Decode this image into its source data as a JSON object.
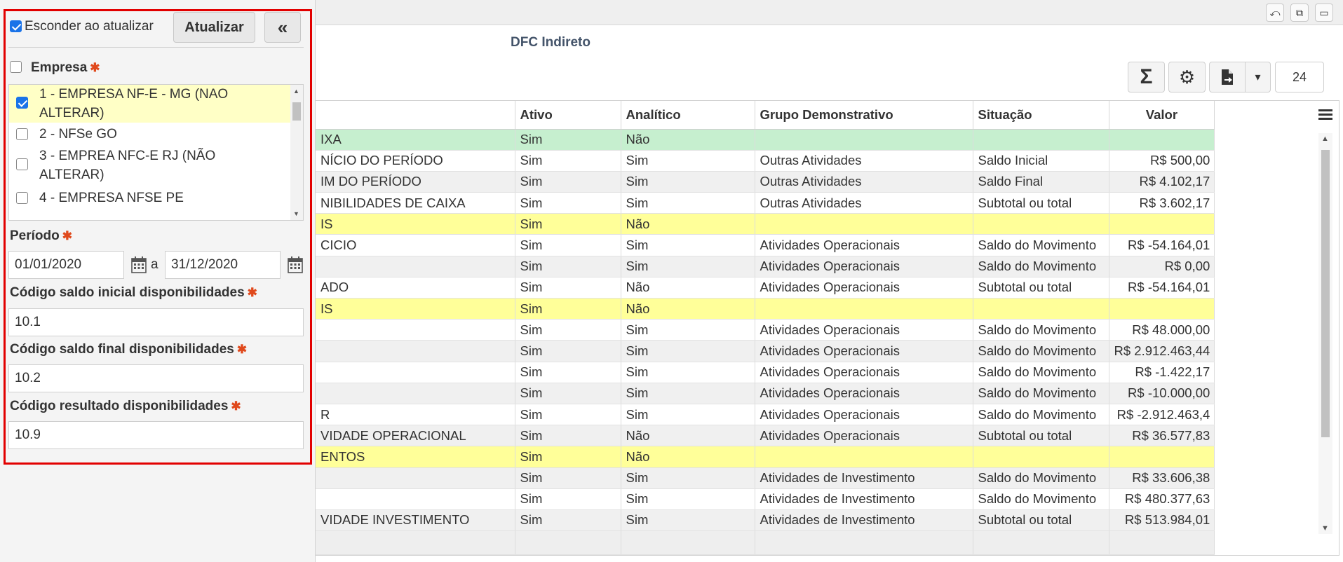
{
  "window": {
    "buttons": [
      {
        "name": "undo",
        "icon": "undo-icon",
        "glyph": "⤺"
      },
      {
        "name": "link",
        "icon": "link-icon",
        "glyph": "⧉"
      },
      {
        "name": "maximize",
        "icon": "maximize-icon",
        "glyph": "▭"
      }
    ]
  },
  "report": {
    "title": "DFC Indireto",
    "toolbar": {
      "sum_glyph": "Σ",
      "settings_glyph": "⚙",
      "export_glyph": "🗎",
      "dropdown_glyph": "▾",
      "page_size": "24"
    },
    "columns": [
      "",
      "Ativo",
      "Analítico",
      "Grupo Demonstrativo",
      "Situação",
      "Valor"
    ],
    "rows": [
      {
        "style": "green",
        "cells": [
          "IXA",
          "Sim",
          "Não",
          "",
          "",
          ""
        ]
      },
      {
        "style": "white",
        "cells": [
          "NÍCIO DO PERÍODO",
          "Sim",
          "Sim",
          "Outras Atividades",
          "Saldo Inicial",
          "R$ 500,00"
        ]
      },
      {
        "style": "gray",
        "cells": [
          "IM DO PERÍODO",
          "Sim",
          "Sim",
          "Outras Atividades",
          "Saldo Final",
          "R$ 4.102,17"
        ]
      },
      {
        "style": "white",
        "cells": [
          "NIBILIDADES DE CAIXA",
          "Sim",
          "Sim",
          "Outras Atividades",
          "Subtotal ou total",
          "R$ 3.602,17"
        ]
      },
      {
        "style": "yellow",
        "cells": [
          "IS",
          "Sim",
          "Não",
          "",
          "",
          ""
        ]
      },
      {
        "style": "white",
        "cells": [
          "CICIO",
          "Sim",
          "Sim",
          "Atividades Operacionais",
          "Saldo do Movimento",
          "R$ -54.164,01"
        ]
      },
      {
        "style": "gray",
        "cells": [
          "",
          "Sim",
          "Sim",
          "Atividades Operacionais",
          "Saldo do Movimento",
          "R$ 0,00"
        ]
      },
      {
        "style": "white",
        "cells": [
          "ADO",
          "Sim",
          "Não",
          "Atividades Operacionais",
          "Subtotal ou total",
          "R$ -54.164,01"
        ]
      },
      {
        "style": "yellow",
        "cells": [
          "IS",
          "Sim",
          "Não",
          "",
          "",
          ""
        ]
      },
      {
        "style": "white",
        "cells": [
          "",
          "Sim",
          "Sim",
          "Atividades Operacionais",
          "Saldo do Movimento",
          "R$ 48.000,00"
        ]
      },
      {
        "style": "gray",
        "cells": [
          "",
          "Sim",
          "Sim",
          "Atividades Operacionais",
          "Saldo do Movimento",
          "R$ 2.912.463,44"
        ]
      },
      {
        "style": "white",
        "cells": [
          "",
          "Sim",
          "Sim",
          "Atividades Operacionais",
          "Saldo do Movimento",
          "R$ -1.422,17"
        ]
      },
      {
        "style": "gray",
        "cells": [
          "",
          "Sim",
          "Sim",
          "Atividades Operacionais",
          "Saldo do Movimento",
          "R$ -10.000,00"
        ]
      },
      {
        "style": "white",
        "cells": [
          "R",
          "Sim",
          "Sim",
          "Atividades Operacionais",
          "Saldo do Movimento",
          "R$ -2.912.463,4"
        ]
      },
      {
        "style": "gray",
        "cells": [
          "VIDADE OPERACIONAL",
          "Sim",
          "Não",
          "Atividades Operacionais",
          "Subtotal ou total",
          "R$ 36.577,83"
        ]
      },
      {
        "style": "yellow",
        "cells": [
          "ENTOS",
          "Sim",
          "Não",
          "",
          "",
          ""
        ]
      },
      {
        "style": "gray",
        "cells": [
          "",
          "Sim",
          "Sim",
          "Atividades de Investimento",
          "Saldo do Movimento",
          "R$ 33.606,38"
        ]
      },
      {
        "style": "white",
        "cells": [
          "",
          "Sim",
          "Sim",
          "Atividades de Investimento",
          "Saldo do Movimento",
          "R$ 480.377,63"
        ]
      },
      {
        "style": "gray",
        "cells": [
          "VIDADE INVESTIMENTO",
          "Sim",
          "Sim",
          "Atividades de Investimento",
          "Subtotal ou total",
          "R$ 513.984,01"
        ]
      }
    ]
  },
  "filters": {
    "hide_on_update_label": "Esconder ao atualizar",
    "hide_on_update_checked": true,
    "update_button": "Atualizar",
    "collapse_glyph": "«",
    "empresa_label": "Empresa",
    "required_mark": "✱",
    "empresas": [
      {
        "line1": "1 - EMPRESA NF-E - MG (NAO",
        "line2": "ALTERAR)",
        "checked": true
      },
      {
        "line1": "2 - NFSe GO",
        "line2": "",
        "checked": false
      },
      {
        "line1": "3 - EMPREA NFC-E RJ (NÃO",
        "line2": "ALTERAR)",
        "checked": false
      },
      {
        "line1": "4 - EMPRESA NFSE PE",
        "line2": "",
        "checked": false
      }
    ],
    "periodo_label": "Período",
    "periodo_from": "01/01/2020",
    "periodo_sep": "a",
    "periodo_to": "31/12/2020",
    "saldo_inicial_label": "Código saldo inicial disponibilidades",
    "saldo_inicial_value": "10.1",
    "saldo_final_label": "Código saldo final disponibilidades",
    "saldo_final_value": "10.2",
    "resultado_label": "Código resultado disponibilidades",
    "resultado_value": "10.9"
  }
}
